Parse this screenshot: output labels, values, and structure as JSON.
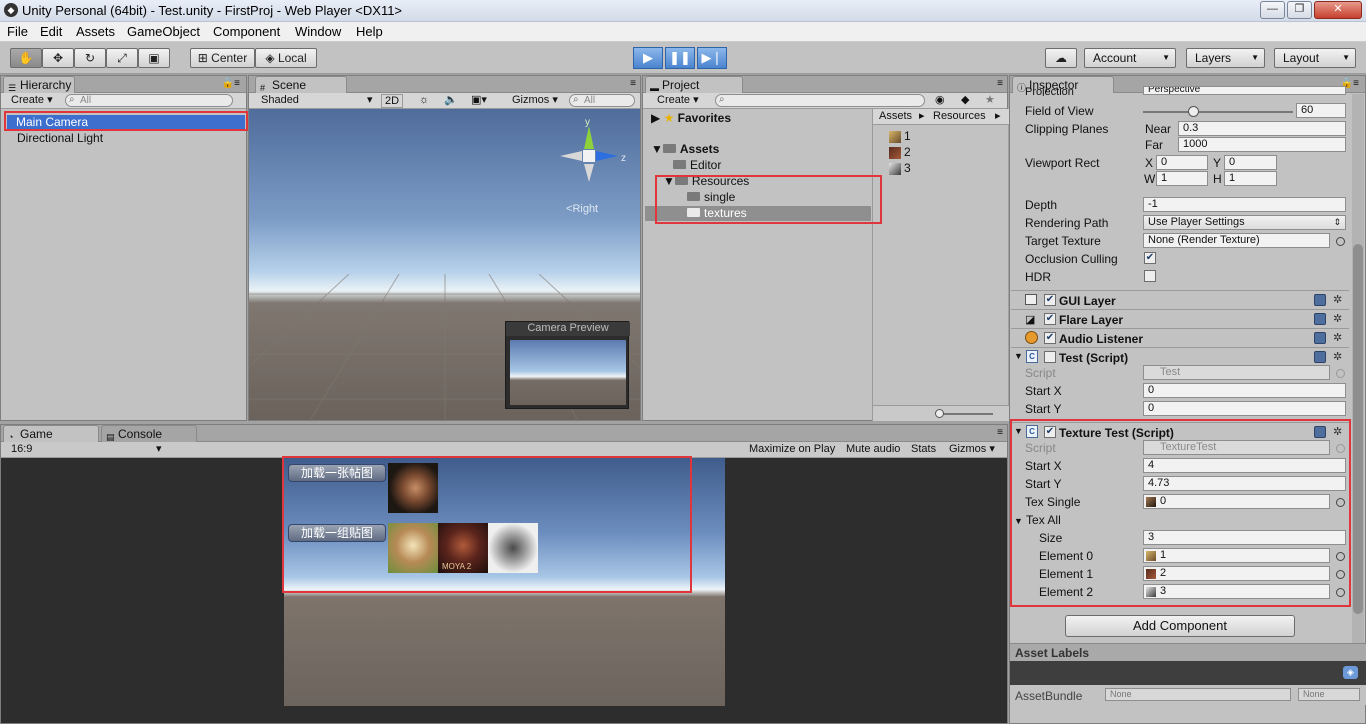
{
  "window": {
    "title": "Unity Personal (64bit) - Test.unity - FirstProj - Web Player <DX11>",
    "btn_min": "—",
    "btn_max": "❐",
    "btn_close": "✕"
  },
  "menu": [
    "File",
    "Edit",
    "Assets",
    "GameObject",
    "Component",
    "Window",
    "Help"
  ],
  "toolbar": {
    "center": "Center",
    "local": "Local",
    "account": "Account",
    "layers": "Layers",
    "layout": "Layout",
    "cloud_glyph": "☁"
  },
  "hierarchy": {
    "tab": "Hierarchy",
    "create": "Create",
    "search_placeholder": "All",
    "items": [
      "Main Camera",
      "Directional Light"
    ]
  },
  "scene": {
    "tab": "Scene",
    "shading": "Shaded",
    "mode2d": "2D",
    "gizmos": "Gizmos",
    "search_placeholder": "All",
    "axis_y": "y",
    "axis_z": "z",
    "view_label": "Right",
    "camera_preview": "Camera Preview"
  },
  "project": {
    "tab": "Project",
    "create": "Create",
    "favorites": "Favorites",
    "assets": "Assets",
    "folders": [
      "Editor",
      "Resources",
      "single",
      "textures"
    ],
    "breadcrumb": [
      "Assets",
      "Resources"
    ],
    "files": [
      "1",
      "2",
      "3"
    ]
  },
  "game": {
    "tab_game": "Game",
    "tab_console": "Console",
    "aspect": "16:9",
    "maximize": "Maximize on Play",
    "mute": "Mute audio",
    "stats": "Stats",
    "gizmos": "Gizmos",
    "btn_single": "加载一张帖图",
    "btn_group": "加载一组贴图",
    "thumb_caption": "MOYA 2"
  },
  "inspector": {
    "tab": "Inspector",
    "projection_label": "Projection",
    "projection_value": "Perspective",
    "fov_label": "Field of View",
    "fov_value": "60",
    "fov_fraction": 0.33,
    "clipping_label": "Clipping Planes",
    "near_label": "Near",
    "near_value": "0.3",
    "far_label": "Far",
    "far_value": "1000",
    "viewport_label": "Viewport Rect",
    "vx_label": "X",
    "vx": "0",
    "vy_label": "Y",
    "vy": "0",
    "vw_label": "W",
    "vw": "1",
    "vh_label": "H",
    "vh": "1",
    "depth_label": "Depth",
    "depth_value": "-1",
    "rpath_label": "Rendering Path",
    "rpath_value": "Use Player Settings",
    "ttex_label": "Target Texture",
    "ttex_value": "None (Render Texture)",
    "occl_label": "Occlusion Culling",
    "hdr_label": "HDR",
    "gui_layer": "GUI Layer",
    "flare_layer": "Flare Layer",
    "audio_listener": "Audio Listener",
    "test_script": "Test (Script)",
    "script_label": "Script",
    "test_script_value": "Test",
    "startx_label": "Start X",
    "test_startx": "0",
    "starty_label": "Start Y",
    "test_starty": "0",
    "texture_test": "Texture Test (Script)",
    "tt_script_value": "TextureTest",
    "tt_startx": "4",
    "tt_starty": "4.73",
    "tex_single_label": "Tex Single",
    "tex_single_value": "0",
    "tex_all_label": "Tex All",
    "size_label": "Size",
    "size_value": "3",
    "elements": [
      {
        "label": "Element 0",
        "value": "1"
      },
      {
        "label": "Element 1",
        "value": "2"
      },
      {
        "label": "Element 2",
        "value": "3"
      }
    ],
    "add_component": "Add Component",
    "asset_labels": "Asset Labels",
    "asset_bundle_label": "AssetBundle",
    "asset_bundle_value": "None",
    "asset_bundle_variant": "None"
  }
}
